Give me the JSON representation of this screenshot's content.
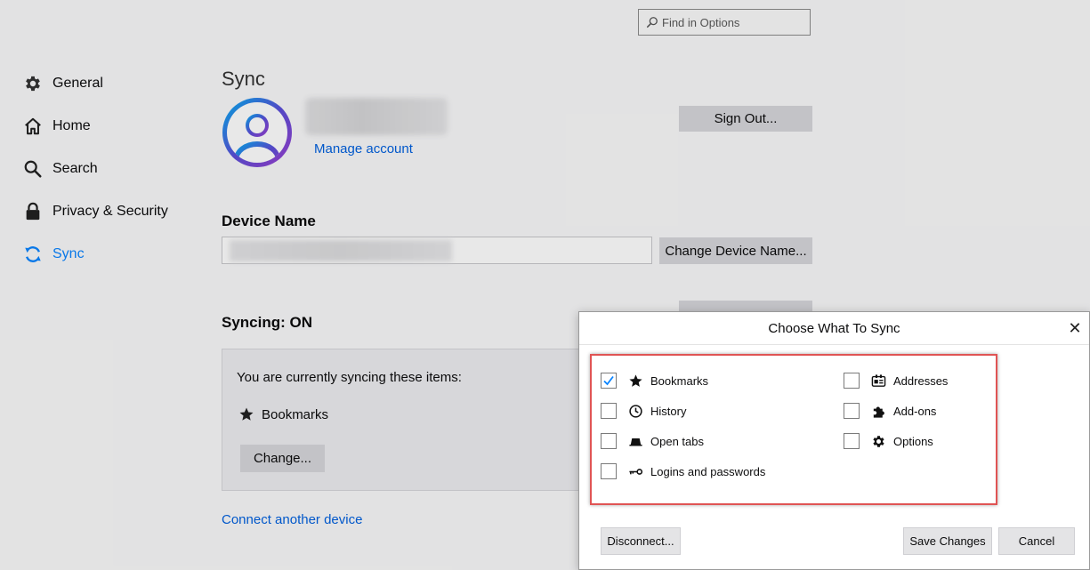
{
  "search": {
    "placeholder": "Find in Options"
  },
  "sidebar": {
    "items": [
      {
        "label": "General",
        "icon": "gear-icon"
      },
      {
        "label": "Home",
        "icon": "home-icon"
      },
      {
        "label": "Search",
        "icon": "search-icon"
      },
      {
        "label": "Privacy & Security",
        "icon": "lock-icon"
      },
      {
        "label": "Sync",
        "icon": "sync-icon",
        "active": true
      }
    ]
  },
  "main": {
    "title": "Sync",
    "manage_account": "Manage account",
    "sign_out": "Sign Out...",
    "device_name_heading": "Device Name",
    "change_device_name": "Change Device Name...",
    "syncing_heading": "Syncing: ON",
    "syncing_text": "You are currently syncing these items:",
    "synced_item": "Bookmarks",
    "change_button": "Change...",
    "connect_device": "Connect another device"
  },
  "dialog": {
    "title": "Choose What To Sync",
    "close": "✕",
    "options": [
      {
        "label": "Bookmarks",
        "checked": true,
        "icon": "star-icon"
      },
      {
        "label": "History",
        "checked": false,
        "icon": "clock-icon"
      },
      {
        "label": "Open tabs",
        "checked": false,
        "icon": "tab-icon"
      },
      {
        "label": "Logins and passwords",
        "checked": false,
        "icon": "key-icon"
      },
      {
        "label": "Addresses",
        "checked": false,
        "icon": "address-card-icon"
      },
      {
        "label": "Add-ons",
        "checked": false,
        "icon": "puzzle-icon"
      },
      {
        "label": "Options",
        "checked": false,
        "icon": "gear-icon"
      }
    ],
    "disconnect": "Disconnect...",
    "save": "Save Changes",
    "cancel": "Cancel"
  },
  "colors": {
    "accent": "#0a84ff",
    "link": "#0060df",
    "highlight": "#e05454"
  }
}
